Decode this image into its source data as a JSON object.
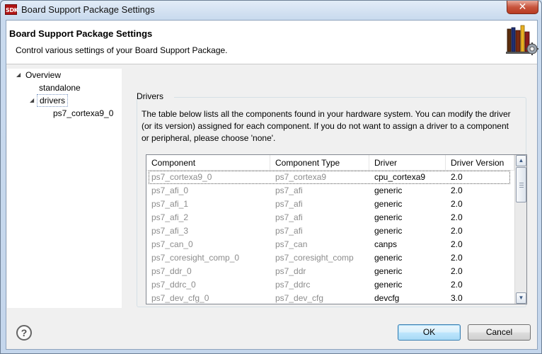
{
  "window": {
    "app_icon_text": "SDK",
    "title": "Board Support Package Settings",
    "close_glyph": "✕"
  },
  "header": {
    "title": "Board Support Package Settings",
    "description": "Control various settings of your Board Support Package."
  },
  "tree": {
    "items": [
      {
        "label": "Overview",
        "level": 0,
        "expanded": true
      },
      {
        "label": "standalone",
        "level": 1
      },
      {
        "label": "drivers",
        "level": 1,
        "expanded": true,
        "selected": true
      },
      {
        "label": "ps7_cortexa9_0",
        "level": 2
      }
    ]
  },
  "drivers": {
    "group_label": "Drivers",
    "description": "The table below lists all the components found in your hardware system. You can modify the driver (or its version) assigned for each component. If you do not want to assign a driver to a component or peripheral, please choose 'none'.",
    "columns": [
      "Component",
      "Component Type",
      "Driver",
      "Driver Version"
    ],
    "rows": [
      [
        "ps7_cortexa9_0",
        "ps7_cortexa9",
        "cpu_cortexa9",
        "2.0"
      ],
      [
        "ps7_afi_0",
        "ps7_afi",
        "generic",
        "2.0"
      ],
      [
        "ps7_afi_1",
        "ps7_afi",
        "generic",
        "2.0"
      ],
      [
        "ps7_afi_2",
        "ps7_afi",
        "generic",
        "2.0"
      ],
      [
        "ps7_afi_3",
        "ps7_afi",
        "generic",
        "2.0"
      ],
      [
        "ps7_can_0",
        "ps7_can",
        "canps",
        "2.0"
      ],
      [
        "ps7_coresight_comp_0",
        "ps7_coresight_comp",
        "generic",
        "2.0"
      ],
      [
        "ps7_ddr_0",
        "ps7_ddr",
        "generic",
        "2.0"
      ],
      [
        "ps7_ddrc_0",
        "ps7_ddrc",
        "generic",
        "2.0"
      ],
      [
        "ps7_dev_cfg_0",
        "ps7_dev_cfg",
        "devcfg",
        "3.0"
      ]
    ]
  },
  "footer": {
    "help_glyph": "?",
    "ok_label": "OK",
    "cancel_label": "Cancel"
  },
  "colors": {
    "title_bar": "#c9daee",
    "close_button": "#c8553e",
    "dialog_bg": "#f0f0f0",
    "default_button": "#bee6fd"
  }
}
